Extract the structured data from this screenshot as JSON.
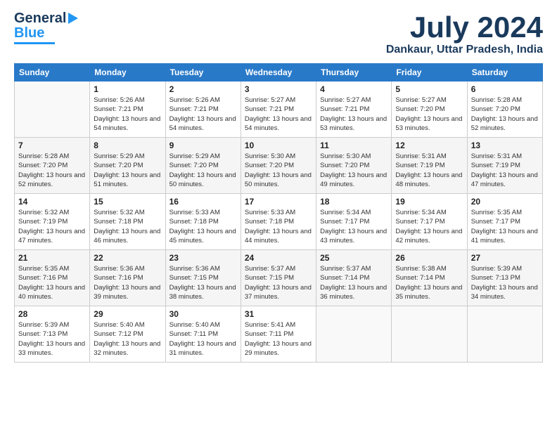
{
  "header": {
    "logo_line1": "General",
    "logo_line2": "Blue",
    "month": "July 2024",
    "location": "Dankaur, Uttar Pradesh, India"
  },
  "weekdays": [
    "Sunday",
    "Monday",
    "Tuesday",
    "Wednesday",
    "Thursday",
    "Friday",
    "Saturday"
  ],
  "weeks": [
    [
      {
        "day": "",
        "sunrise": "",
        "sunset": "",
        "daylight": ""
      },
      {
        "day": "1",
        "sunrise": "Sunrise: 5:26 AM",
        "sunset": "Sunset: 7:21 PM",
        "daylight": "Daylight: 13 hours and 54 minutes."
      },
      {
        "day": "2",
        "sunrise": "Sunrise: 5:26 AM",
        "sunset": "Sunset: 7:21 PM",
        "daylight": "Daylight: 13 hours and 54 minutes."
      },
      {
        "day": "3",
        "sunrise": "Sunrise: 5:27 AM",
        "sunset": "Sunset: 7:21 PM",
        "daylight": "Daylight: 13 hours and 54 minutes."
      },
      {
        "day": "4",
        "sunrise": "Sunrise: 5:27 AM",
        "sunset": "Sunset: 7:21 PM",
        "daylight": "Daylight: 13 hours and 53 minutes."
      },
      {
        "day": "5",
        "sunrise": "Sunrise: 5:27 AM",
        "sunset": "Sunset: 7:20 PM",
        "daylight": "Daylight: 13 hours and 53 minutes."
      },
      {
        "day": "6",
        "sunrise": "Sunrise: 5:28 AM",
        "sunset": "Sunset: 7:20 PM",
        "daylight": "Daylight: 13 hours and 52 minutes."
      }
    ],
    [
      {
        "day": "7",
        "sunrise": "Sunrise: 5:28 AM",
        "sunset": "Sunset: 7:20 PM",
        "daylight": "Daylight: 13 hours and 52 minutes."
      },
      {
        "day": "8",
        "sunrise": "Sunrise: 5:29 AM",
        "sunset": "Sunset: 7:20 PM",
        "daylight": "Daylight: 13 hours and 51 minutes."
      },
      {
        "day": "9",
        "sunrise": "Sunrise: 5:29 AM",
        "sunset": "Sunset: 7:20 PM",
        "daylight": "Daylight: 13 hours and 50 minutes."
      },
      {
        "day": "10",
        "sunrise": "Sunrise: 5:30 AM",
        "sunset": "Sunset: 7:20 PM",
        "daylight": "Daylight: 13 hours and 50 minutes."
      },
      {
        "day": "11",
        "sunrise": "Sunrise: 5:30 AM",
        "sunset": "Sunset: 7:20 PM",
        "daylight": "Daylight: 13 hours and 49 minutes."
      },
      {
        "day": "12",
        "sunrise": "Sunrise: 5:31 AM",
        "sunset": "Sunset: 7:19 PM",
        "daylight": "Daylight: 13 hours and 48 minutes."
      },
      {
        "day": "13",
        "sunrise": "Sunrise: 5:31 AM",
        "sunset": "Sunset: 7:19 PM",
        "daylight": "Daylight: 13 hours and 47 minutes."
      }
    ],
    [
      {
        "day": "14",
        "sunrise": "Sunrise: 5:32 AM",
        "sunset": "Sunset: 7:19 PM",
        "daylight": "Daylight: 13 hours and 47 minutes."
      },
      {
        "day": "15",
        "sunrise": "Sunrise: 5:32 AM",
        "sunset": "Sunset: 7:18 PM",
        "daylight": "Daylight: 13 hours and 46 minutes."
      },
      {
        "day": "16",
        "sunrise": "Sunrise: 5:33 AM",
        "sunset": "Sunset: 7:18 PM",
        "daylight": "Daylight: 13 hours and 45 minutes."
      },
      {
        "day": "17",
        "sunrise": "Sunrise: 5:33 AM",
        "sunset": "Sunset: 7:18 PM",
        "daylight": "Daylight: 13 hours and 44 minutes."
      },
      {
        "day": "18",
        "sunrise": "Sunrise: 5:34 AM",
        "sunset": "Sunset: 7:17 PM",
        "daylight": "Daylight: 13 hours and 43 minutes."
      },
      {
        "day": "19",
        "sunrise": "Sunrise: 5:34 AM",
        "sunset": "Sunset: 7:17 PM",
        "daylight": "Daylight: 13 hours and 42 minutes."
      },
      {
        "day": "20",
        "sunrise": "Sunrise: 5:35 AM",
        "sunset": "Sunset: 7:17 PM",
        "daylight": "Daylight: 13 hours and 41 minutes."
      }
    ],
    [
      {
        "day": "21",
        "sunrise": "Sunrise: 5:35 AM",
        "sunset": "Sunset: 7:16 PM",
        "daylight": "Daylight: 13 hours and 40 minutes."
      },
      {
        "day": "22",
        "sunrise": "Sunrise: 5:36 AM",
        "sunset": "Sunset: 7:16 PM",
        "daylight": "Daylight: 13 hours and 39 minutes."
      },
      {
        "day": "23",
        "sunrise": "Sunrise: 5:36 AM",
        "sunset": "Sunset: 7:15 PM",
        "daylight": "Daylight: 13 hours and 38 minutes."
      },
      {
        "day": "24",
        "sunrise": "Sunrise: 5:37 AM",
        "sunset": "Sunset: 7:15 PM",
        "daylight": "Daylight: 13 hours and 37 minutes."
      },
      {
        "day": "25",
        "sunrise": "Sunrise: 5:37 AM",
        "sunset": "Sunset: 7:14 PM",
        "daylight": "Daylight: 13 hours and 36 minutes."
      },
      {
        "day": "26",
        "sunrise": "Sunrise: 5:38 AM",
        "sunset": "Sunset: 7:14 PM",
        "daylight": "Daylight: 13 hours and 35 minutes."
      },
      {
        "day": "27",
        "sunrise": "Sunrise: 5:39 AM",
        "sunset": "Sunset: 7:13 PM",
        "daylight": "Daylight: 13 hours and 34 minutes."
      }
    ],
    [
      {
        "day": "28",
        "sunrise": "Sunrise: 5:39 AM",
        "sunset": "Sunset: 7:13 PM",
        "daylight": "Daylight: 13 hours and 33 minutes."
      },
      {
        "day": "29",
        "sunrise": "Sunrise: 5:40 AM",
        "sunset": "Sunset: 7:12 PM",
        "daylight": "Daylight: 13 hours and 32 minutes."
      },
      {
        "day": "30",
        "sunrise": "Sunrise: 5:40 AM",
        "sunset": "Sunset: 7:11 PM",
        "daylight": "Daylight: 13 hours and 31 minutes."
      },
      {
        "day": "31",
        "sunrise": "Sunrise: 5:41 AM",
        "sunset": "Sunset: 7:11 PM",
        "daylight": "Daylight: 13 hours and 29 minutes."
      },
      {
        "day": "",
        "sunrise": "",
        "sunset": "",
        "daylight": ""
      },
      {
        "day": "",
        "sunrise": "",
        "sunset": "",
        "daylight": ""
      },
      {
        "day": "",
        "sunrise": "",
        "sunset": "",
        "daylight": ""
      }
    ]
  ]
}
